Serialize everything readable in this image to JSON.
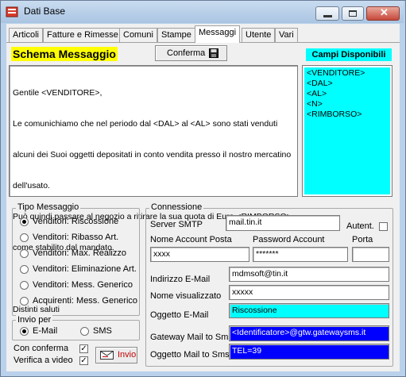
{
  "window": {
    "title": "Dati Base",
    "controls": [
      "minimize-icon",
      "maximize-icon",
      "close-icon"
    ]
  },
  "tabs": [
    {
      "label": "Articoli"
    },
    {
      "label": "Fatture e Rimesse"
    },
    {
      "label": "Comuni"
    },
    {
      "label": "Stampe"
    },
    {
      "label": "Messaggi",
      "active": true
    },
    {
      "label": "Utente"
    },
    {
      "label": "Vari"
    }
  ],
  "schema": {
    "title": "Schema Messaggio",
    "confirm_label": "Conferma",
    "message_lines": [
      "Gentile <VENDITORE>,",
      "Le comunichiamo che nel periodo dal <DAL> al <AL> sono stati venduti",
      "alcuni dei Suoi oggetti depositati in conto vendita presso il nostro mercatino",
      "dell'usato.",
      "Può quindi passare al negozio a ritirare la sua quota di Euro <RIMBORSO>",
      "come stabilito dal mandato.",
      "",
      "Distinti saluti"
    ]
  },
  "campi": {
    "title": "Campi Disponibili",
    "items": [
      "<VENDITORE>",
      "<DAL>",
      "<AL>",
      "<N>",
      "<RIMBORSO>"
    ]
  },
  "tipo_messaggio": {
    "label": "Tipo Messaggio",
    "options": [
      {
        "label": "Venditori: Riscossione",
        "selected": true
      },
      {
        "label": "Venditori: Ribasso Art.",
        "selected": false
      },
      {
        "label": "Venditori: Max. Realizzo",
        "selected": false
      },
      {
        "label": "Venditori: Eliminazione Art.",
        "selected": false
      },
      {
        "label": "Venditori: Mess. Generico",
        "selected": false
      },
      {
        "label": "Acquirenti: Mess. Generico",
        "selected": false
      }
    ]
  },
  "invio_per": {
    "label": "Invio per",
    "email_label": "E-Mail",
    "sms_label": "SMS",
    "selected": "E-Mail"
  },
  "options": {
    "con_conferma_label": "Con conferma",
    "con_conferma_checked": true,
    "verifica_label": "Verifica a video",
    "verifica_checked": true,
    "invio_label": "Invio"
  },
  "connessione": {
    "label": "Connessione",
    "server_label": "Server SMTP",
    "server_value": "mail.tin.it",
    "autent_label": "Autent.",
    "autent_checked": false,
    "account_label": "Nome Account Posta",
    "account_value": "xxxx",
    "password_label": "Password Account",
    "password_value": "*******",
    "porta_label": "Porta",
    "porta_value": "",
    "email_label": "Indirizzo E-Mail",
    "email_value": "mdmsoft@tin.it",
    "nome_label": "Nome visualizzato",
    "nome_value": "xxxxx",
    "oggetto_label": "Oggetto E-Mail",
    "oggetto_value": "Riscossione",
    "gateway_label": "Gateway Mail to Sms",
    "gateway_value": "<Identificatore>@gtw.gatewaysms.it",
    "oggetto_sms_label": "Oggetto Mail to Sms",
    "oggetto_sms_value": "TEL=39"
  },
  "colors": {
    "highlight_yellow": "#ffff00",
    "cyan": "#00ffff",
    "blue": "#0000ff"
  }
}
